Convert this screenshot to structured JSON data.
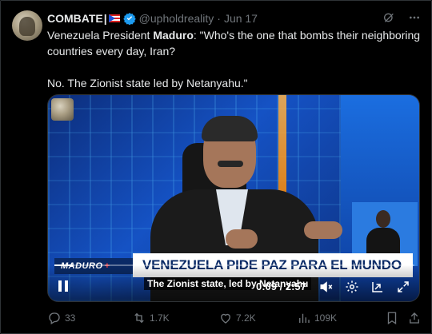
{
  "author": {
    "name": "COMBATE",
    "name_suffix": "|",
    "flag_icon": "puerto-rico-flag-icon",
    "verified": true,
    "handle": "@upholdreality",
    "date_separator": "·",
    "date": "Jun 17"
  },
  "tweet": {
    "line1_pre": "Venezuela President ",
    "line1_bold": "Maduro",
    "line1_post": ": \"Who's the one that bombs their neighboring countries every day, Iran?",
    "line2": "No. The Zionist state led by Netanyahu.\""
  },
  "video": {
    "program_tag": "MADURO",
    "program_plus": "+",
    "headline": "VENEZUELA PIDE PAZ PARA EL MUNDO",
    "subtitle": "The Zionist state, led by Netanyahu",
    "time": "0:09 / 2:57",
    "progress": 0.051
  },
  "actions": {
    "replies": "33",
    "reposts": "1.7K",
    "likes": "7.2K",
    "views": "109K"
  },
  "colors": {
    "background": "#000000",
    "text": "#e7e9ea",
    "muted": "#71767b",
    "verified": "#1d9bf0",
    "headline_blue": "#0a2a66"
  }
}
